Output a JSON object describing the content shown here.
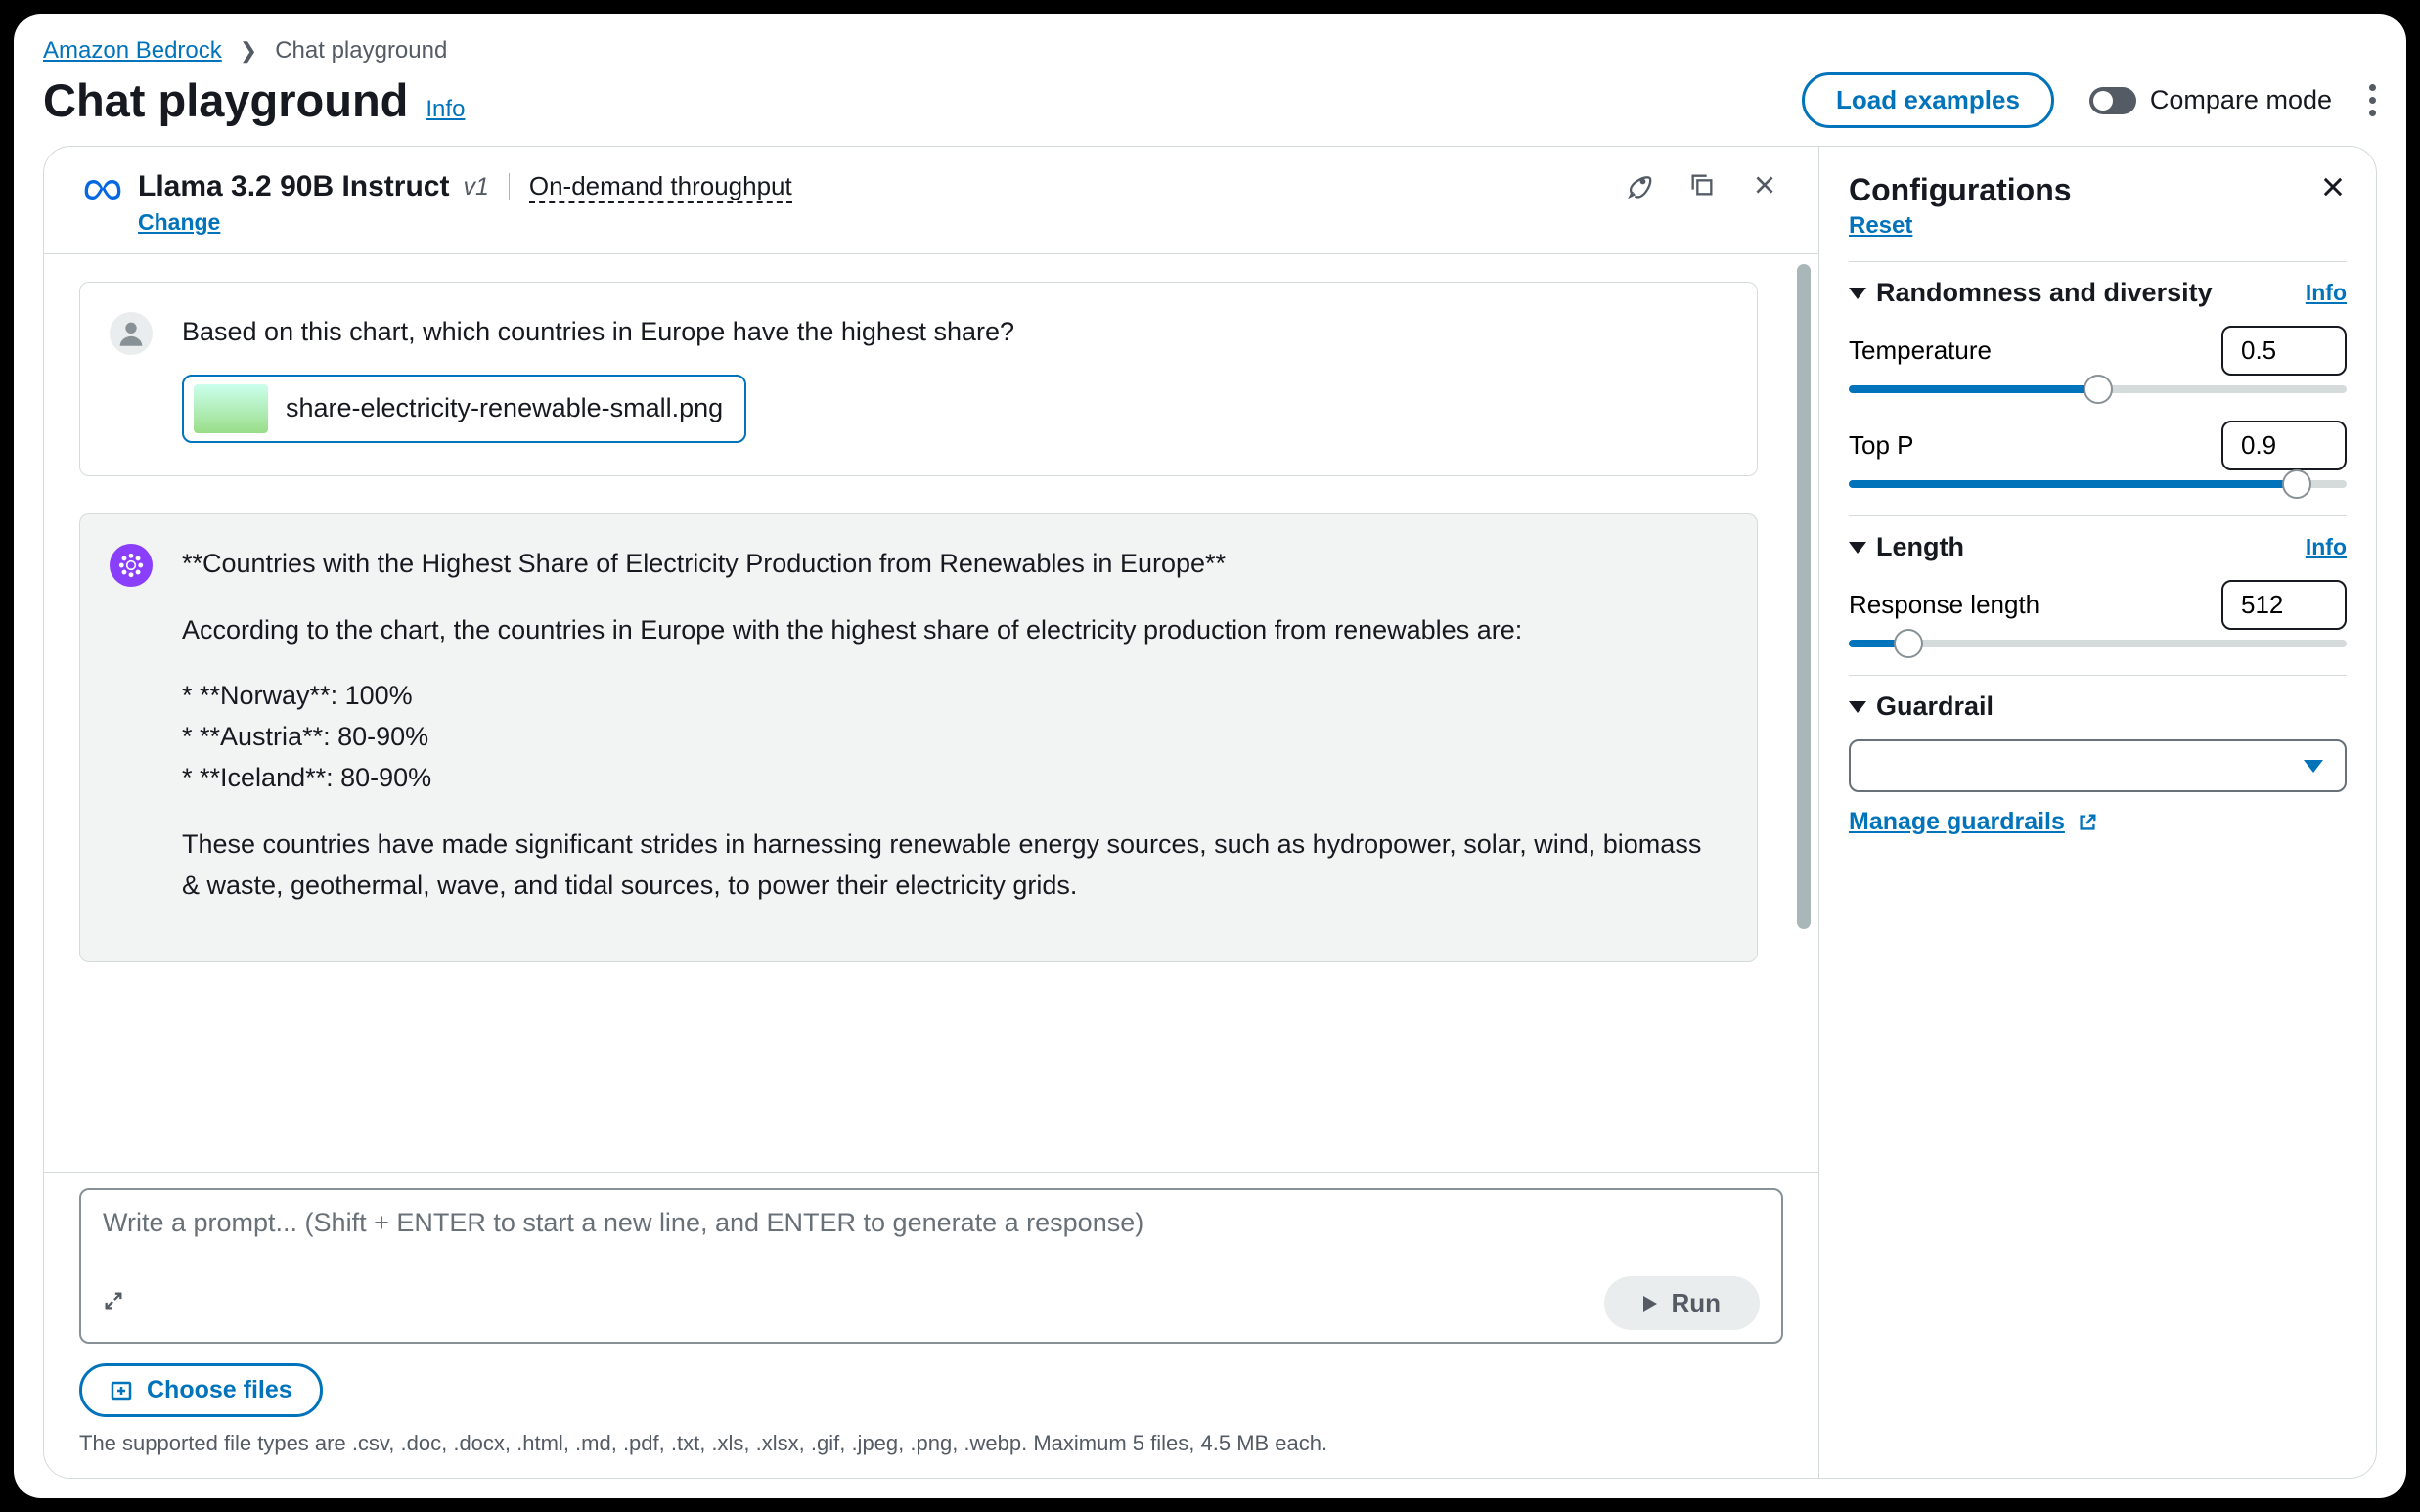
{
  "breadcrumb": {
    "root": "Amazon Bedrock",
    "current": "Chat playground"
  },
  "page": {
    "title": "Chat playground",
    "info": "Info"
  },
  "header": {
    "load_examples": "Load examples",
    "compare_mode": "Compare mode"
  },
  "model": {
    "name": "Llama 3.2 90B Instruct",
    "version": "v1",
    "throughput": "On-demand throughput",
    "change": "Change"
  },
  "chat": {
    "user_msg": "Based on this chart, which countries in Europe have the highest share?",
    "attachment_name": "share-electricity-renewable-small.png",
    "assistant": {
      "heading": "**Countries with the Highest Share of Electricity Production from Renewables in Europe**",
      "intro": "According to the chart, the countries in Europe with the highest share of electricity production from renewables are:",
      "bullets": [
        "**Norway**: 100%",
        "**Austria**: 80-90%",
        "**Iceland**: 80-90%"
      ],
      "outro": "These countries have made significant strides in harnessing renewable energy sources, such as hydropower, solar, wind, biomass & waste, geothermal, wave, and tidal sources, to power their electricity grids."
    }
  },
  "input": {
    "placeholder": "Write a prompt... (Shift + ENTER to start a new line, and ENTER to generate a response)",
    "run": "Run",
    "choose_files": "Choose files",
    "hint": "The supported file types are .csv, .doc, .docx, .html, .md, .pdf, .txt, .xls, .xlsx, .gif, .jpeg, .png, .webp. Maximum 5 files, 4.5 MB each."
  },
  "config": {
    "title": "Configurations",
    "reset": "Reset",
    "info": "Info",
    "sections": {
      "randomness": {
        "title": "Randomness and diversity",
        "temperature_label": "Temperature",
        "temperature_value": "0.5",
        "top_p_label": "Top P",
        "top_p_value": "0.9"
      },
      "length": {
        "title": "Length",
        "response_len_label": "Response length",
        "response_len_value": "512"
      },
      "guardrail": {
        "title": "Guardrail",
        "manage": "Manage guardrails"
      }
    }
  }
}
